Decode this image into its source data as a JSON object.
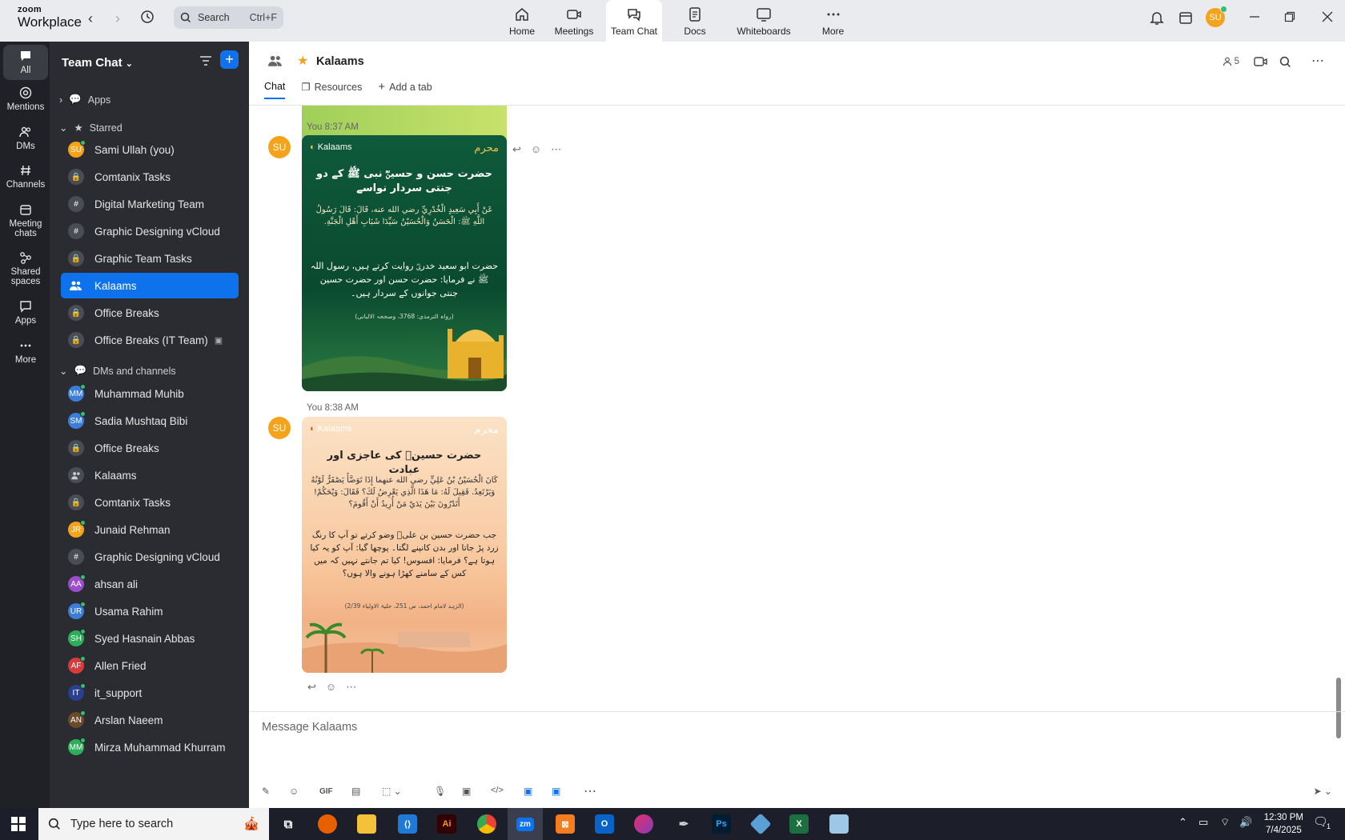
{
  "topbar": {
    "brand_top": "zoom",
    "brand_bottom": "Workplace",
    "search_placeholder": "Search",
    "search_shortcut": "Ctrl+F",
    "tabs": [
      {
        "label": "Home",
        "icon": "home-icon"
      },
      {
        "label": "Meetings",
        "icon": "video-icon"
      },
      {
        "label": "Team Chat",
        "icon": "chat-icon",
        "active": true
      },
      {
        "label": "Docs",
        "icon": "doc-icon"
      },
      {
        "label": "Whiteboards",
        "icon": "whiteboard-icon"
      },
      {
        "label": "More",
        "icon": "more-icon"
      }
    ],
    "user_initials": "SU",
    "user_color": "#f5a31a"
  },
  "rail": {
    "items": [
      {
        "label": "All",
        "icon": "chat-bubble-icon",
        "active": true
      },
      {
        "label": "Mentions",
        "icon": "at-icon"
      },
      {
        "label": "DMs",
        "icon": "users-icon"
      },
      {
        "label": "Channels",
        "icon": "hash-icon"
      },
      {
        "label": "Meeting chats",
        "icon": "calendar-icon"
      },
      {
        "label": "Shared spaces",
        "icon": "shared-spaces-icon"
      },
      {
        "label": "Apps",
        "icon": "apps-icon"
      },
      {
        "label": "More",
        "icon": "more-icon"
      }
    ]
  },
  "sidebar": {
    "title": "Team Chat",
    "apps_label": "Apps",
    "starred_label": "Starred",
    "dms_label": "DMs and channels",
    "starred": [
      {
        "label": "Sami Ullah (you)",
        "type": "avatar",
        "initials": "SU",
        "color": "#f5a31a",
        "presence": true
      },
      {
        "label": "Comtanix Tasks",
        "type": "lock"
      },
      {
        "label": "Digital Marketing Team",
        "type": "hash"
      },
      {
        "label": "Graphic Designing vCloud",
        "type": "hash"
      },
      {
        "label": "Graphic Team Tasks",
        "type": "lock"
      },
      {
        "label": "Kalaams",
        "type": "group",
        "active": true
      },
      {
        "label": "Office Breaks",
        "type": "lock"
      },
      {
        "label": "Office Breaks (IT Team)",
        "type": "lock",
        "archived": true
      }
    ],
    "dms": [
      {
        "label": "Muhammad Muhib",
        "type": "avatar",
        "initials": "MM",
        "color": "#3b7dd8",
        "presence": true
      },
      {
        "label": "Sadia Mushtaq Bibi",
        "type": "avatar",
        "initials": "SM",
        "color": "#3b7dd8",
        "presence": true
      },
      {
        "label": "Office Breaks",
        "type": "lock"
      },
      {
        "label": "Kalaams",
        "type": "group"
      },
      {
        "label": "Comtanix Tasks",
        "type": "lock"
      },
      {
        "label": "Junaid Rehman",
        "type": "avatar",
        "initials": "JR",
        "color": "#f5a31a",
        "presence": true
      },
      {
        "label": "Graphic Designing vCloud",
        "type": "hash"
      },
      {
        "label": "ahsan ali",
        "type": "avatar",
        "initials": "AA",
        "color": "#9c4dcc",
        "presence": true
      },
      {
        "label": "Usama Rahim",
        "type": "avatar",
        "initials": "UR",
        "color": "#3b7dd8",
        "presence": true
      },
      {
        "label": "Syed Hasnain Abbas",
        "type": "avatar",
        "initials": "SH",
        "color": "#2dae5a",
        "presence": true
      },
      {
        "label": "Allen Fried",
        "type": "avatar",
        "initials": "AF",
        "color": "#d83b3b",
        "presence": true
      },
      {
        "label": "it_support",
        "type": "avatar",
        "initials": "IT",
        "color": "#2a3f8f",
        "presence": true
      },
      {
        "label": "Arslan Naeem",
        "type": "avatar",
        "initials": "AN",
        "color": "#6b4a2a",
        "presence": true
      },
      {
        "label": "Mirza Muhammad Khurram",
        "type": "avatar",
        "initials": "MM",
        "color": "#2dae5a",
        "presence": true
      }
    ]
  },
  "main": {
    "title": "Kalaams",
    "member_count": "5",
    "tabs": [
      "Chat",
      "Resources",
      "Add a tab"
    ],
    "messages": [
      {
        "sender": "You",
        "time": "8:37 AM",
        "avatar": "SU",
        "card": {
          "logo": "Kalaams",
          "badge": "محرم",
          "title": "حضرت حسن و حسینؓ نبی ﷺ کے دو جنتی سردار نواسے",
          "arabic": "عَنْ أَبِي سَعِيدٍ الْخُدْرِيِّ رضي الله عنه، قَالَ: قَالَ رَسُولُ اللَّهِ ﷺ: الْحَسَنُ وَالْحُسَيْنُ سَيِّدَا شَبَابِ أَهْلِ الْجَنَّةِ.",
          "urdu": "حضرت ابو سعید خدریؓ روایت کرتے ہیں، رسول اللہ ﷺ نے فرمایا: حضرت حسن اور حضرت حسین جنتی جوانوں کے سردار ہیں۔",
          "reference": "(رواہ الترمذی: 3768، وصححہ الالبانی)"
        }
      },
      {
        "sender": "You",
        "time": "8:38 AM",
        "avatar": "SU",
        "card": {
          "logo": "Kalaams",
          "badge": "محرم",
          "title": "حضرت حسینؓ کی عاجزی اور عبادت",
          "arabic": "كَانَ الْحُسَيْنُ بْنُ عَلِيٍّ رضي الله عنهما إِذَا تَوَضَّأَ يَصْفَرُّ لَوْنُهُ وَيَرْتَعِدُ. فَقِيلَ لَهُ: مَا هَذَا الَّذِي يَعْرِضُ لَكَ؟ فَقَالَ: وَيْحَكُمْ! أَتَدْرُونَ بَيْنَ يَدَيْ مَنْ أُرِيدُ أَنْ أَقُومَ؟",
          "urdu": "جب حضرت حسین بن علیؓ وضو کرتے تو آپ کا رنگ زرد پڑ جاتا اور بدن کانپنے لگتا۔ پوچھا گیا: آپ کو یہ کیا ہوتا ہے؟ فرمایا: افسوس! کیا تم جانتے نہیں کہ میں کس کے سامنے کھڑا ہونے والا ہوں؟",
          "reference": "(الزہد لامام احمد، ص 251، حلیۃ الاولیاء 2/39)"
        }
      }
    ],
    "composer_placeholder": "Message Kalaams"
  },
  "taskbar": {
    "search_placeholder": "Type here to search",
    "time": "12:30 PM",
    "date": "7/4/2025",
    "notification_count": "1",
    "apps": [
      "task-view-icon",
      "firefox-icon",
      "file-explorer-icon",
      "vscode-icon",
      "illustrator-icon",
      "chrome-icon",
      "zoom-icon",
      "xampp-icon",
      "outlook-icon",
      "creative-cloud-icon",
      "pen-tool-icon",
      "photoshop-icon",
      "app-icon",
      "excel-icon",
      "notepad-icon"
    ]
  }
}
